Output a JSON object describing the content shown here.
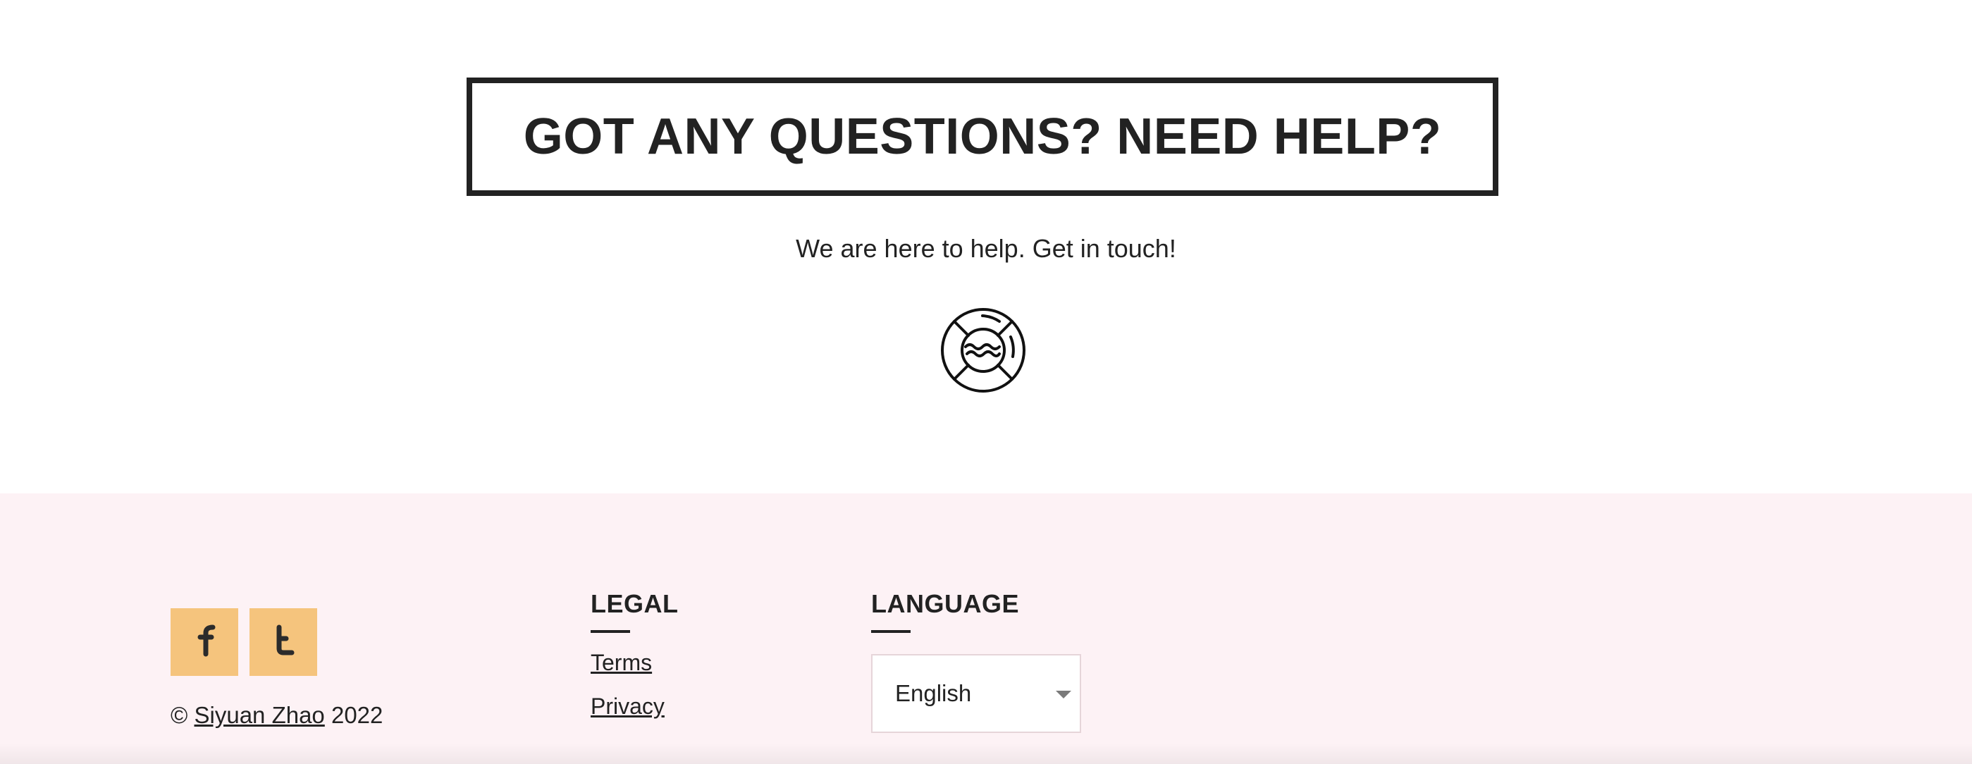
{
  "help": {
    "title": "GOT ANY QUESTIONS? NEED HELP?",
    "subtitle": "We are here to help. Get in touch!",
    "icon": "lifebuoy-icon"
  },
  "footer": {
    "social": [
      {
        "name": "facebook",
        "icon": "facebook-icon",
        "color": "#f5c47d"
      },
      {
        "name": "tumblr",
        "icon": "tumblr-icon",
        "color": "#f5c47d"
      }
    ],
    "copyright": {
      "symbol": "©",
      "author": "Siyuan Zhao",
      "year": "2022"
    },
    "legal": {
      "heading": "LEGAL",
      "links": [
        "Terms",
        "Privacy"
      ]
    },
    "language": {
      "heading": "LANGUAGE",
      "selected": "English"
    },
    "colors": {
      "background": "#fdf2f5",
      "social_bg": "#f5c47d",
      "text": "#222222"
    }
  }
}
